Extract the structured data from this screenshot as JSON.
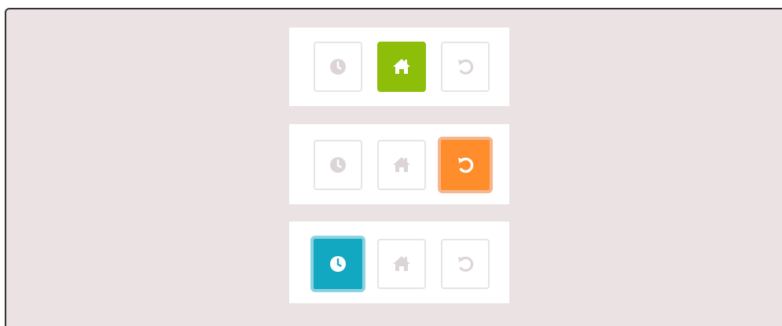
{
  "colors": {
    "background": "#ebe3e3",
    "panel": "#ffffff",
    "inactive_icon": "#ddd5d5",
    "green_active": "#8cbe0a",
    "orange_active": "#ff8d2c",
    "orange_ring": "#f4b691",
    "blue_active": "#13a8c1",
    "blue_ring": "#8bd3e0"
  },
  "button_groups": [
    {
      "active": "home",
      "buttons": [
        {
          "icon": "clock-icon",
          "state": "inactive"
        },
        {
          "icon": "home-icon",
          "state": "active",
          "color": "green"
        },
        {
          "icon": "refresh-icon",
          "state": "inactive"
        }
      ]
    },
    {
      "active": "refresh",
      "buttons": [
        {
          "icon": "clock-icon",
          "state": "inactive"
        },
        {
          "icon": "home-icon",
          "state": "inactive"
        },
        {
          "icon": "refresh-icon",
          "state": "active",
          "color": "orange"
        }
      ]
    },
    {
      "active": "clock",
      "buttons": [
        {
          "icon": "clock-icon",
          "state": "active",
          "color": "blue"
        },
        {
          "icon": "home-icon",
          "state": "inactive"
        },
        {
          "icon": "refresh-icon",
          "state": "inactive"
        }
      ]
    }
  ]
}
